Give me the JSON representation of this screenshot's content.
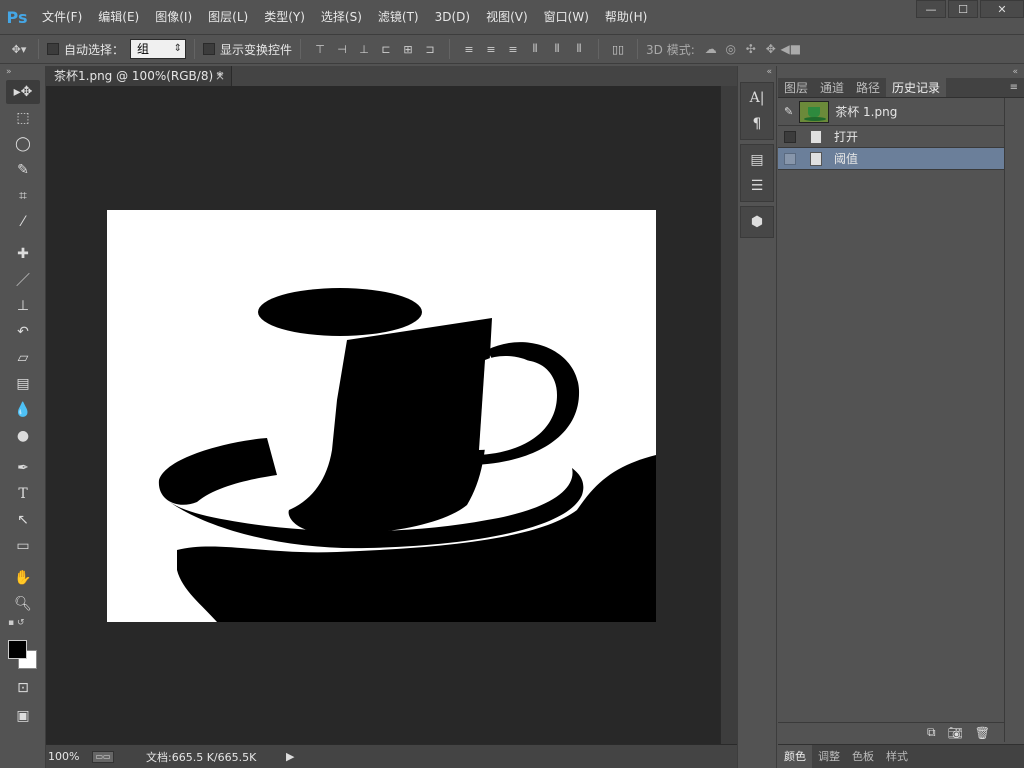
{
  "app": {
    "logo": "Ps"
  },
  "menu": [
    "文件(F)",
    "编辑(E)",
    "图像(I)",
    "图层(L)",
    "类型(Y)",
    "选择(S)",
    "滤镜(T)",
    "3D(D)",
    "视图(V)",
    "窗口(W)",
    "帮助(H)"
  ],
  "window_controls": {
    "minimize": "—",
    "maximize": "☐",
    "close": "✕"
  },
  "options": {
    "auto_select_label": "自动选择：",
    "auto_select_value": "组",
    "show_transform_label": "显示变换控件",
    "mode3d_label": "3D 模式:"
  },
  "document": {
    "tab_title": "茶杯1.png @ 100%(RGB/8) *",
    "tab_close": "×",
    "zoom": "100%",
    "doc_size": "文档:665.5 K/665.5K",
    "status_arrow": "▶"
  },
  "panel": {
    "tabs": [
      "图层",
      "通道",
      "路径",
      "历史记录"
    ],
    "active_tab": "历史记录",
    "menu_icon": "≡",
    "snapshot_name": "茶杯 1.png",
    "history": [
      {
        "label": "打开",
        "selected": false
      },
      {
        "label": "阈值",
        "selected": true
      }
    ],
    "bottom_tabs": [
      "颜色",
      "调整",
      "色板",
      "样式"
    ]
  },
  "colors": {
    "foreground": "#000000",
    "background": "#ffffff",
    "selection": "#6b7f9a",
    "logo": "#45a6e5"
  }
}
